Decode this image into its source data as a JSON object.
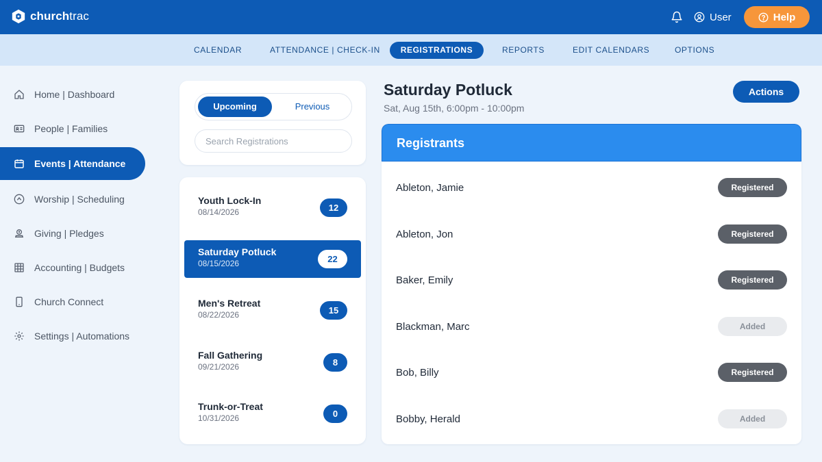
{
  "app": {
    "logo_bold": "church",
    "logo_light": "trac",
    "user_label": "User",
    "help_label": "Help"
  },
  "subnav": [
    {
      "label": "CALENDAR",
      "active": false
    },
    {
      "label": "ATTENDANCE | CHECK-IN",
      "active": false
    },
    {
      "label": "REGISTRATIONS",
      "active": true
    },
    {
      "label": "REPORTS",
      "active": false
    },
    {
      "label": "EDIT CALENDARS",
      "active": false
    },
    {
      "label": "OPTIONS",
      "active": false
    }
  ],
  "sidebar": [
    {
      "label": "Home | Dashboard",
      "icon": "home-icon",
      "active": false
    },
    {
      "label": "People | Families",
      "icon": "id-card-icon",
      "active": false
    },
    {
      "label": "Events | Attendance",
      "icon": "calendar-icon",
      "active": true
    },
    {
      "label": "Worship | Scheduling",
      "icon": "music-circle-icon",
      "active": false
    },
    {
      "label": "Giving | Pledges",
      "icon": "giving-icon",
      "active": false
    },
    {
      "label": "Accounting | Budgets",
      "icon": "grid-icon",
      "active": false
    },
    {
      "label": "Church Connect",
      "icon": "phone-icon",
      "active": false
    },
    {
      "label": "Settings | Automations",
      "icon": "gear-icon",
      "active": false
    }
  ],
  "filters": {
    "upcoming_label": "Upcoming",
    "previous_label": "Previous",
    "active_toggle": "Upcoming",
    "search_placeholder": "Search Registrations",
    "search_value": ""
  },
  "events": [
    {
      "name": "Youth Lock-In",
      "date": "08/14/2026",
      "count": "12",
      "active": false
    },
    {
      "name": "Saturday Potluck",
      "date": "08/15/2026",
      "count": "22",
      "active": true
    },
    {
      "name": "Men's Retreat",
      "date": "08/22/2026",
      "count": "15",
      "active": false
    },
    {
      "name": "Fall Gathering",
      "date": "09/21/2026",
      "count": "8",
      "active": false
    },
    {
      "name": "Trunk-or-Treat",
      "date": "10/31/2026",
      "count": "0",
      "active": false
    }
  ],
  "detail": {
    "title": "Saturday Potluck",
    "datetime": "Sat, Aug 15th, 6:00pm - 10:00pm",
    "actions_label": "Actions",
    "panel_title": "Registrants",
    "registrants": [
      {
        "name": "Ableton, Jamie",
        "status": "Registered"
      },
      {
        "name": "Ableton, Jon",
        "status": "Registered"
      },
      {
        "name": "Baker, Emily",
        "status": "Registered"
      },
      {
        "name": "Blackman, Marc",
        "status": "Added"
      },
      {
        "name": "Bob, Billy",
        "status": "Registered"
      },
      {
        "name": "Bobby, Herald",
        "status": "Added"
      }
    ]
  },
  "colors": {
    "brand_blue": "#0d5bb5",
    "header_blue": "#2b8cee",
    "help_orange": "#f7963a",
    "registered_badge": "#5b6068",
    "added_badge": "#e9ebee"
  }
}
